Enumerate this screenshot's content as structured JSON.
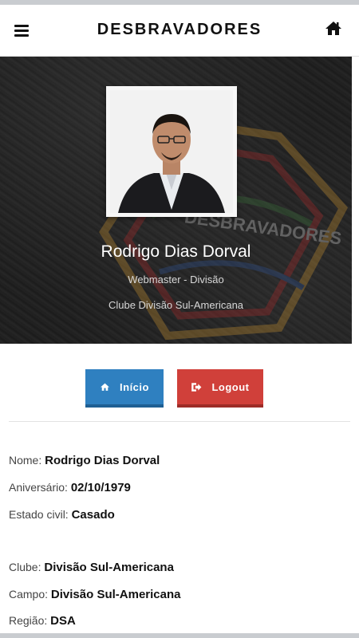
{
  "header": {
    "title": "DESBRAVADORES",
    "menu_icon": "hamburger-menu-icon",
    "home_icon": "home-icon"
  },
  "profile": {
    "name": "Rodrigo Dias Dorval",
    "role": "Webmaster - Divisão",
    "club": "Clube Divisão Sul-Americana"
  },
  "actions": {
    "inicio_label": "Início",
    "logout_label": "Logout"
  },
  "details": {
    "nome_label": "Nome:",
    "nome_value": "Rodrigo Dias Dorval",
    "aniversario_label": "Aniversário:",
    "aniversario_value": "02/10/1979",
    "estado_civil_label": "Estado civil:",
    "estado_civil_value": "Casado",
    "clube_label": "Clube:",
    "clube_value": "Divisão Sul-Americana",
    "campo_label": "Campo:",
    "campo_value": "Divisão Sul-Americana",
    "regiao_label": "Região:",
    "regiao_value": "DSA"
  },
  "colors": {
    "inicio": "#2f80c0",
    "logout": "#d0403a",
    "hero_bg": "#1d1d1d"
  }
}
